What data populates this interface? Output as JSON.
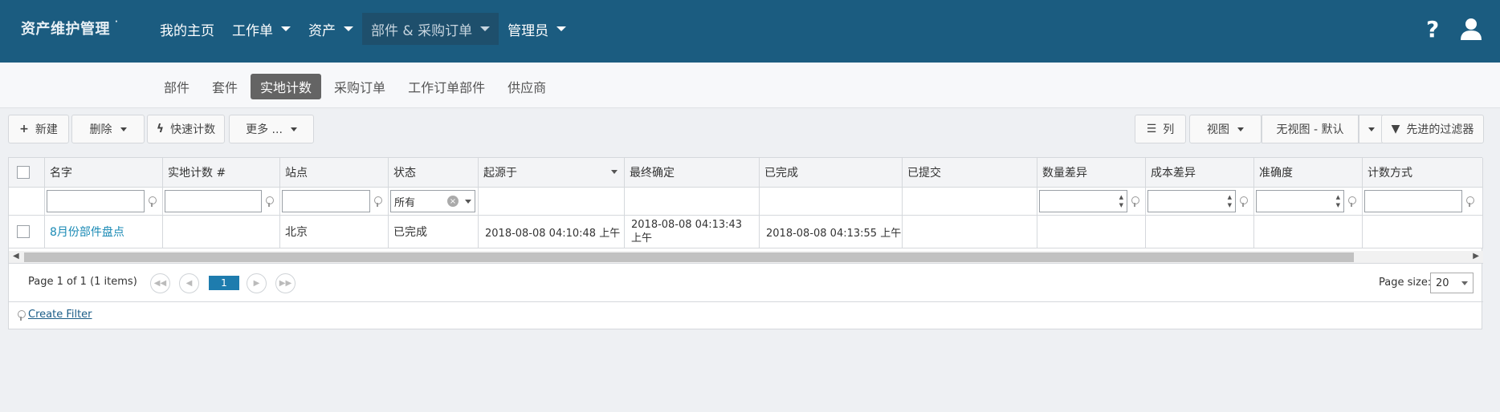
{
  "app": {
    "brand": "资产维护管理",
    "brand_mark": "·"
  },
  "nav": {
    "items": [
      {
        "label": "我的主页",
        "has_caret": false
      },
      {
        "label": "工作单",
        "has_caret": true
      },
      {
        "label": "资产",
        "has_caret": true
      },
      {
        "label": "部件 & 采购订单",
        "has_caret": true,
        "active": true
      },
      {
        "label": "管理员",
        "has_caret": true
      }
    ],
    "help": "?"
  },
  "subnav": {
    "items": [
      "部件",
      "套件",
      "实地计数",
      "采购订单",
      "工作订单部件",
      "供应商"
    ],
    "active": "实地计数"
  },
  "toolbar": {
    "new_label": "新建",
    "delete_label": "删除",
    "quick_count_label": "快速计数",
    "more_label": "更多 ...",
    "columns_label": "列",
    "view_label": "视图",
    "view_value": "无视图 - 默认",
    "advanced_filter_label": "先进的过滤器"
  },
  "table": {
    "columns": [
      "名字",
      "实地计数 #",
      "站点",
      "状态",
      "起源于",
      "最终确定",
      "已完成",
      "已提交",
      "数量差异",
      "成本差异",
      "准确度",
      "计数方式"
    ],
    "status_filter": "所有",
    "rows": [
      {
        "name": "8月份部件盘点",
        "count_no": "",
        "site": "北京",
        "status": "已完成",
        "originated": "2018-08-08 04:10:48 上午",
        "finalized": "2018-08-08 04:13:43 上午",
        "completed": "2018-08-08 04:13:55 上午",
        "submitted": "",
        "qty_diff": "",
        "cost_diff": "",
        "accuracy": "",
        "count_method": ""
      }
    ]
  },
  "pager": {
    "info": "Page 1 of 1 (1 items)",
    "current": "1",
    "size_label": "Page size:",
    "size": "20"
  },
  "create_filter": "Create Filter",
  "colors": {
    "topbar": "#1b5c80",
    "active_nav": "#1e4f6c",
    "pager_current": "#1e7cae",
    "link": "#1a8ab5"
  }
}
